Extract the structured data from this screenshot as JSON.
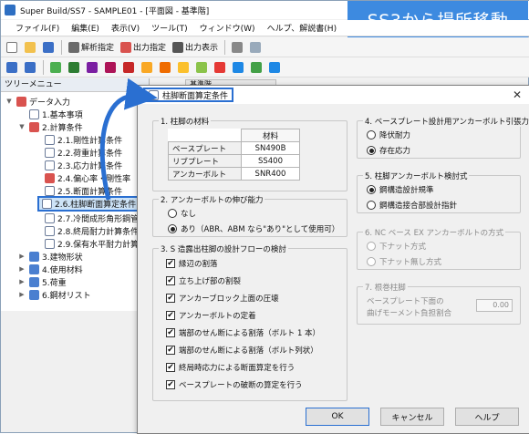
{
  "window": {
    "title": "Super Build/SS7 - SAMPLE01 - [平面図 - 基準階]"
  },
  "banner": {
    "text": "SS3から場所移動"
  },
  "menu": [
    "ファイル(F)",
    "編集(E)",
    "表示(V)",
    "ツール(T)",
    "ウィンドウ(W)",
    "ヘルプ、解説書(H)"
  ],
  "toolbar": {
    "calc_spec": "解析指定",
    "output_spec": "出力指定",
    "output_display": "出力表示"
  },
  "tree": {
    "header": "ツリーメニュー",
    "items": [
      {
        "label": "データ入力"
      },
      {
        "label": "1.基本事項"
      },
      {
        "label": "2.計算条件"
      },
      {
        "label": "2.1.剛性計算条件"
      },
      {
        "label": "2.2.荷重計算条件"
      },
      {
        "label": "2.3.応力計算条件"
      },
      {
        "label": "2.4.偏心率・剛性率"
      },
      {
        "label": "2.5.断面計算条件"
      },
      {
        "label": "2.6.柱脚断面算定条件"
      },
      {
        "label": "2.7.冷間成形角形鋼管"
      },
      {
        "label": "2.8.終局耐力計算条件"
      },
      {
        "label": "2.9.保有水平耐力計算条件"
      },
      {
        "label": "3.建物形状"
      },
      {
        "label": "4.使用材料"
      },
      {
        "label": "5.荷重"
      },
      {
        "label": "6.鋼材リスト"
      }
    ]
  },
  "tab_hint": "基準階",
  "dialog": {
    "title": "柱脚断面算定条件",
    "g1": {
      "label": "1. 柱脚の材料",
      "col_header": "材料",
      "rows": [
        {
          "name": "ベースプレート",
          "value": "SN490B"
        },
        {
          "name": "リブプレート",
          "value": "SS400"
        },
        {
          "name": "アンカーボルト",
          "value": "SNR400"
        }
      ]
    },
    "g2": {
      "label": "2. アンカーボルトの伸び能力",
      "opt1": "なし",
      "opt2": "あり（ABR、ABM なら\"あり\"として使用可）"
    },
    "g3": {
      "label": "3. S 造露出柱脚の設計フローの検討",
      "items": [
        "縁辺の割落",
        "立ち上げ部の割裂",
        "アンカーブロック上面の圧壊",
        "アンカーボルトの定着",
        "端部のせん断による割落（ボルト 1 本）",
        "端部のせん断による割落（ボルト列状）",
        "終局時応力による断面算定を行う",
        "ベースプレートの破断の算定を行う"
      ]
    },
    "g4": {
      "label": "4. ベースプレート設計用アンカーボルト引張力",
      "opt1": "降伏耐力",
      "opt2": "存在応力"
    },
    "g5": {
      "label": "5. 柱脚アンカーボルト検討式",
      "opt1": "鋼構造設計規準",
      "opt2": "鋼構造接合部設計指針"
    },
    "g6": {
      "label": "6. NC ベース EX アンカーボルトの方式",
      "opt1": "下ナット方式",
      "opt2": "下ナット無し方式"
    },
    "g7": {
      "label": "7. 根巻柱脚",
      "text1": "ベースプレート下面の",
      "text2": "曲げモーメント負担割合",
      "value": "0.00"
    },
    "buttons": {
      "ok": "OK",
      "cancel": "キャンセル",
      "help": "ヘルプ"
    }
  }
}
